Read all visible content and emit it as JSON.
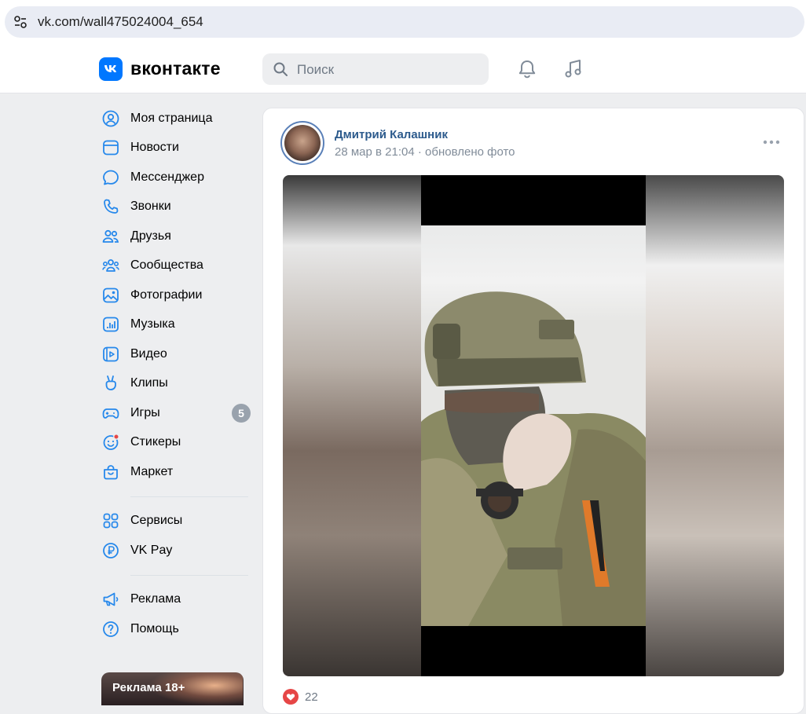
{
  "browser": {
    "url": "vk.com/wall475024004_654"
  },
  "header": {
    "logo_text": "вконтакте",
    "search_placeholder": "Поиск",
    "brand_color": "#0077ff"
  },
  "sidebar": {
    "items": [
      {
        "label": "Моя страница",
        "icon": "user-circle-icon"
      },
      {
        "label": "Новости",
        "icon": "news-icon"
      },
      {
        "label": "Мессенджер",
        "icon": "message-icon"
      },
      {
        "label": "Звонки",
        "icon": "phone-icon"
      },
      {
        "label": "Друзья",
        "icon": "friends-icon"
      },
      {
        "label": "Сообщества",
        "icon": "communities-icon"
      },
      {
        "label": "Фотографии",
        "icon": "photos-icon"
      },
      {
        "label": "Музыка",
        "icon": "music-icon"
      },
      {
        "label": "Видео",
        "icon": "video-icon"
      },
      {
        "label": "Клипы",
        "icon": "clips-icon"
      },
      {
        "label": "Игры",
        "icon": "gamepad-icon",
        "badge": "5"
      },
      {
        "label": "Стикеры",
        "icon": "sticker-icon"
      },
      {
        "label": "Маркет",
        "icon": "market-icon"
      }
    ],
    "items2": [
      {
        "label": "Сервисы",
        "icon": "services-icon"
      },
      {
        "label": "VK Pay",
        "icon": "vkpay-icon"
      }
    ],
    "items3": [
      {
        "label": "Реклама",
        "icon": "megaphone-icon"
      },
      {
        "label": "Помощь",
        "icon": "help-icon"
      }
    ],
    "ad_label": "Реклама 18+"
  },
  "post": {
    "author": "Дмитрий Калашник",
    "date": "28 мар в 21:04",
    "action": "обновлено фото",
    "likes": "22"
  }
}
